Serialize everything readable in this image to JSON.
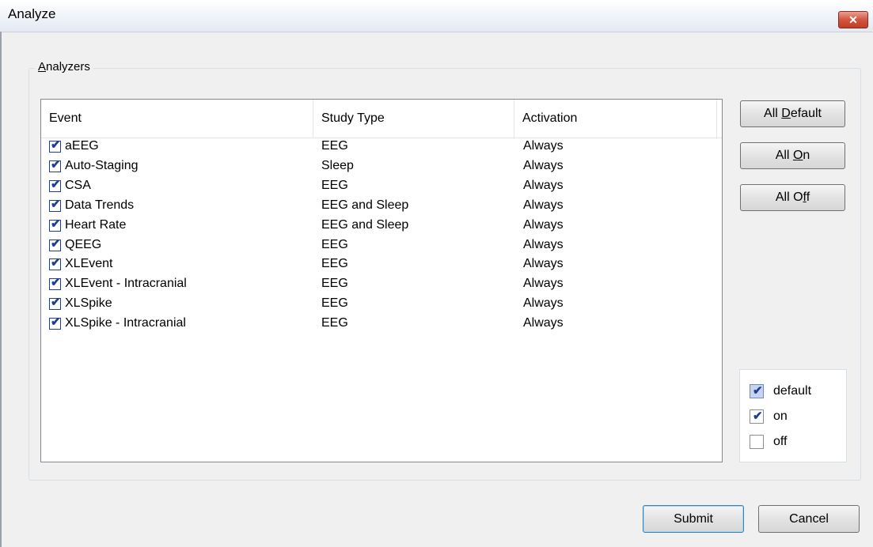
{
  "window": {
    "title": "Analyze",
    "close_glyph": "✕"
  },
  "group": {
    "label_mnemonic": "A",
    "label_rest": "nalyzers"
  },
  "columns": [
    "Event",
    "Study Type",
    "Activation"
  ],
  "rows": [
    {
      "event": "aEEG",
      "study_type": "EEG",
      "activation": "Always",
      "checked": true
    },
    {
      "event": "Auto-Staging",
      "study_type": "Sleep",
      "activation": "Always",
      "checked": true
    },
    {
      "event": "CSA",
      "study_type": "EEG",
      "activation": "Always",
      "checked": true
    },
    {
      "event": "Data Trends",
      "study_type": "EEG and Sleep",
      "activation": "Always",
      "checked": true
    },
    {
      "event": "Heart Rate",
      "study_type": "EEG and Sleep",
      "activation": "Always",
      "checked": true
    },
    {
      "event": "QEEG",
      "study_type": "EEG",
      "activation": "Always",
      "checked": true
    },
    {
      "event": "XLEvent",
      "study_type": "EEG",
      "activation": "Always",
      "checked": true
    },
    {
      "event": "XLEvent - Intracranial",
      "study_type": "EEG",
      "activation": "Always",
      "checked": true
    },
    {
      "event": "XLSpike",
      "study_type": "EEG",
      "activation": "Always",
      "checked": true
    },
    {
      "event": "XLSpike - Intracranial",
      "study_type": "EEG",
      "activation": "Always",
      "checked": true
    }
  ],
  "side_buttons": {
    "all_default": {
      "pre": "All ",
      "mn": "D",
      "post": "efault"
    },
    "all_on": {
      "pre": "All ",
      "mn": "O",
      "post": "n"
    },
    "all_off": {
      "pre": "All O",
      "mn": "f",
      "post": "f"
    }
  },
  "legend": [
    {
      "label": "default",
      "state": "default"
    },
    {
      "label": "on",
      "state": "on"
    },
    {
      "label": "off",
      "state": "off"
    }
  ],
  "footer": {
    "submit": "Submit",
    "cancel": "Cancel"
  },
  "icons": {
    "checkbox": "checkbox-icon",
    "close": "close-icon"
  },
  "colors": {
    "check": "#1c3f94",
    "close_button": "#c9452f"
  }
}
